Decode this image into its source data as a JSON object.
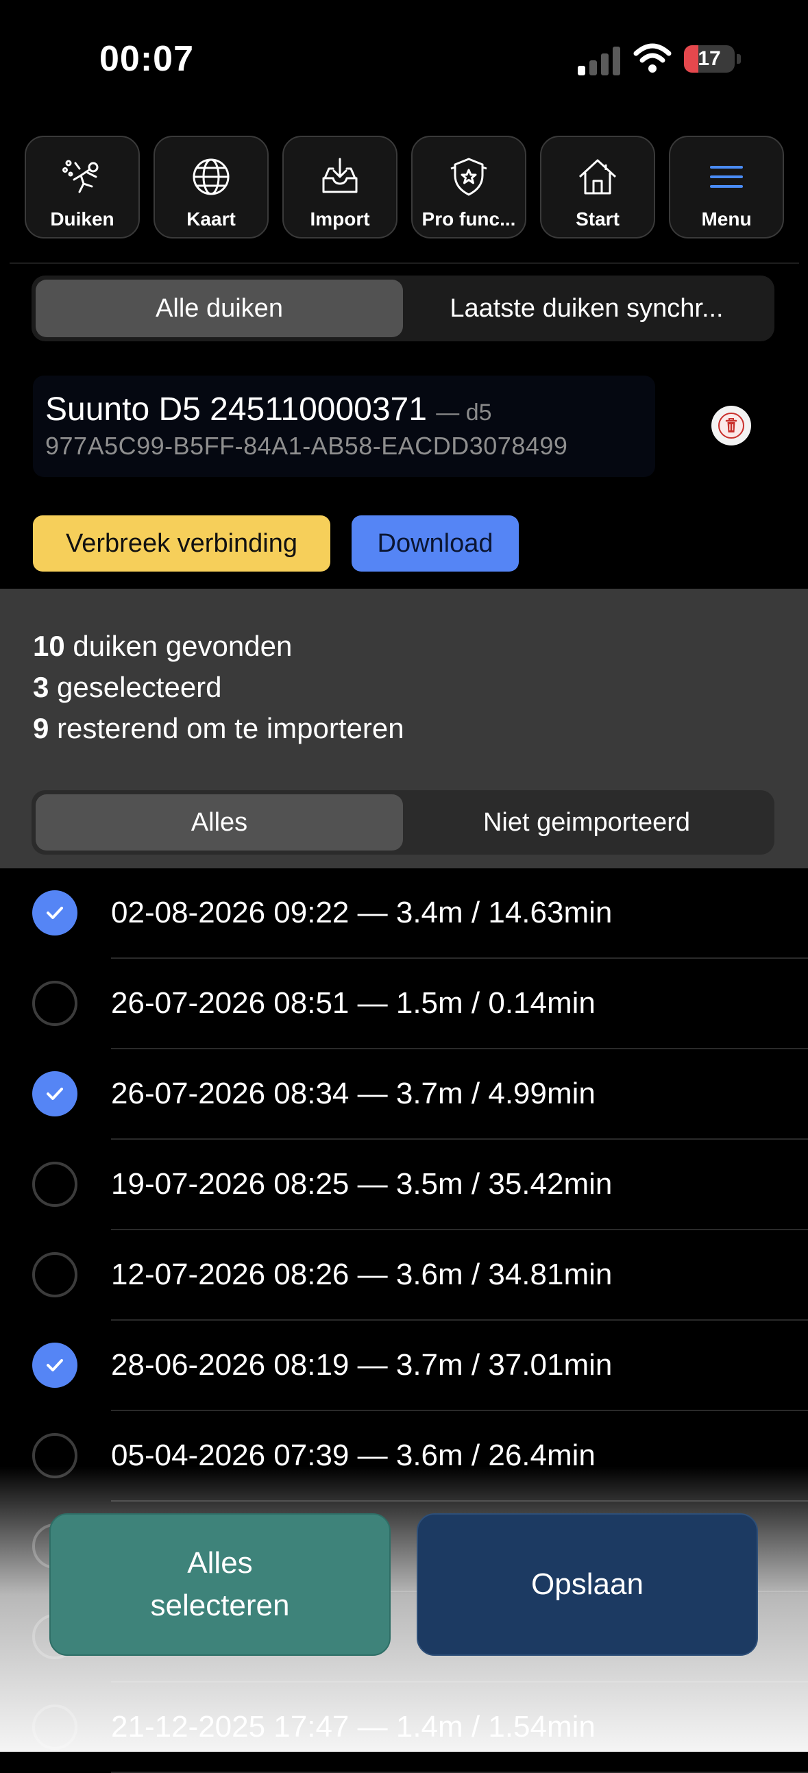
{
  "status_bar": {
    "time": "00:07",
    "battery": "17"
  },
  "toolbar": [
    {
      "label": "Duiken",
      "icon": "diver-icon"
    },
    {
      "label": "Kaart",
      "icon": "globe-icon"
    },
    {
      "label": "Import",
      "icon": "inbox-download-icon"
    },
    {
      "label": "Pro func...",
      "icon": "shield-star-icon"
    },
    {
      "label": "Start",
      "icon": "home-icon"
    },
    {
      "label": "Menu",
      "icon": "hamburger-menu-icon"
    }
  ],
  "colors": {
    "accent": "#5585f5",
    "warning": "#f6cf5a",
    "select_all": "#3e837a",
    "save": "#1c3a62",
    "menu_icon": "#4a8cf7"
  },
  "view_tabs": {
    "all": "Alle duiken",
    "sync": "Laatste duiken synchr...",
    "selected": "all"
  },
  "device": {
    "name": "Suunto D5 245110000371",
    "model": "— d5",
    "uuid": "977A5C99-B5FF-84A1-AB58-EACDD3078499"
  },
  "actions": {
    "disconnect": "Verbreek verbinding",
    "download": "Download"
  },
  "stats": {
    "found_count": "10",
    "found_text": "duiken gevonden",
    "selected_count": "3",
    "selected_text": "geselecteerd",
    "remaining_count": "9",
    "remaining_text": "resterend om te importeren"
  },
  "filter_tabs": {
    "all": "Alles",
    "not_imported": "Niet geimporteerd",
    "selected": "all"
  },
  "dives": [
    {
      "label": "02-08-2026 09:22 — 3.4m / 14.63min",
      "checked": true
    },
    {
      "label": "26-07-2026 08:51 — 1.5m / 0.14min",
      "checked": false
    },
    {
      "label": "26-07-2026 08:34 — 3.7m / 4.99min",
      "checked": true
    },
    {
      "label": "19-07-2026 08:25 — 3.5m / 35.42min",
      "checked": false
    },
    {
      "label": "12-07-2026 08:26 — 3.6m / 34.81min",
      "checked": false
    },
    {
      "label": "28-06-2026 08:19 — 3.7m / 37.01min",
      "checked": true
    },
    {
      "label": "05-04-2026 07:39 — 3.6m / 26.4min",
      "checked": false
    },
    {
      "label": "",
      "checked": false
    },
    {
      "label": "",
      "checked": false
    },
    {
      "label": "21-12-2025 17:47 — 1.4m / 1.54min",
      "checked": false
    }
  ],
  "bottom_actions": {
    "select_all_line1": "Alles",
    "select_all_line2": "selecteren",
    "save": "Opslaan"
  }
}
